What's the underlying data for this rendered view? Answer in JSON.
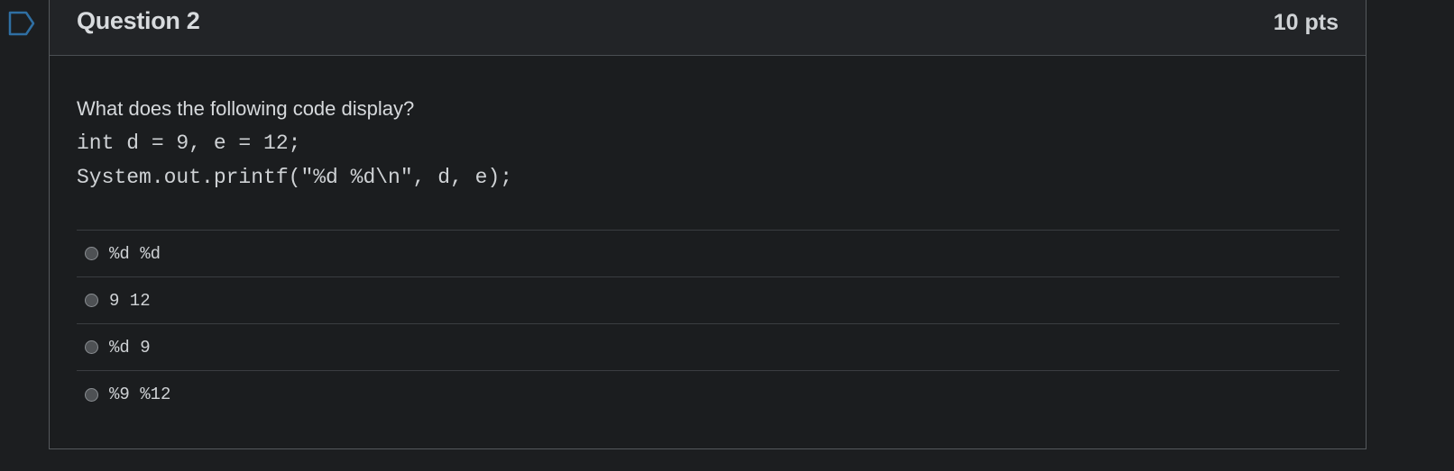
{
  "question": {
    "title": "Question 2",
    "points": "10 pts",
    "prompt": "What does the following code display?",
    "code_lines": [
      "int d = 9, e = 12;",
      "System.out.printf(\"%d %d\\n\", d, e);"
    ]
  },
  "answers": [
    {
      "label": "%d %d"
    },
    {
      "label": "9 12"
    },
    {
      "label": "%d 9"
    },
    {
      "label": "%9 %12"
    }
  ],
  "colors": {
    "background": "#1c1e20",
    "header_background": "#222427",
    "border": "#55595c",
    "flag_outline": "#2f6fa3"
  },
  "icons": {
    "flag": "flag-question-icon",
    "radio": "radio-unselected-icon"
  }
}
